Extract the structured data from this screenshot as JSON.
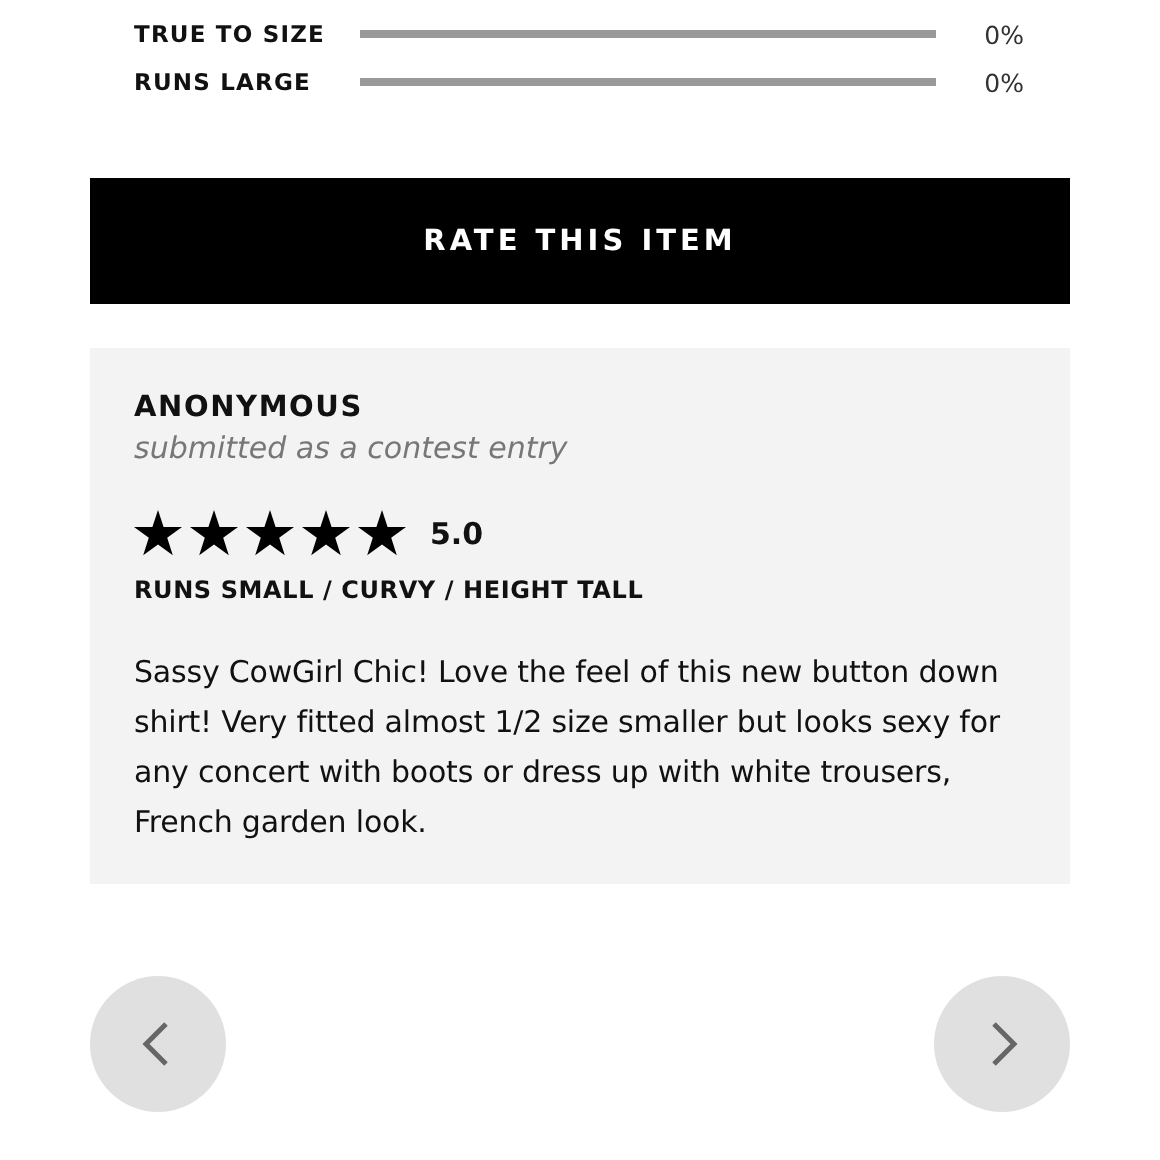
{
  "fit_ratings": [
    {
      "label": "TRUE TO SIZE",
      "level": 0,
      "reading": "0%"
    },
    {
      "label": "RUNS LARGE",
      "level": 0,
      "reading": "0%"
    }
  ],
  "rate_button": "RATE THIS ITEM",
  "review": {
    "author": "ANONYMOUS",
    "note": "submitted as a contest entry",
    "stars": 5,
    "score": "5.0",
    "fit": "RUNS SMALL / CURVY / HEIGHT TALL",
    "body": "Sassy CowGirl Chic! Love the feel of this new button down shirt! Very fitted almost 1/2 size smaller but looks sexy for any concert with boots or dress up with white trousers, French garden look."
  }
}
